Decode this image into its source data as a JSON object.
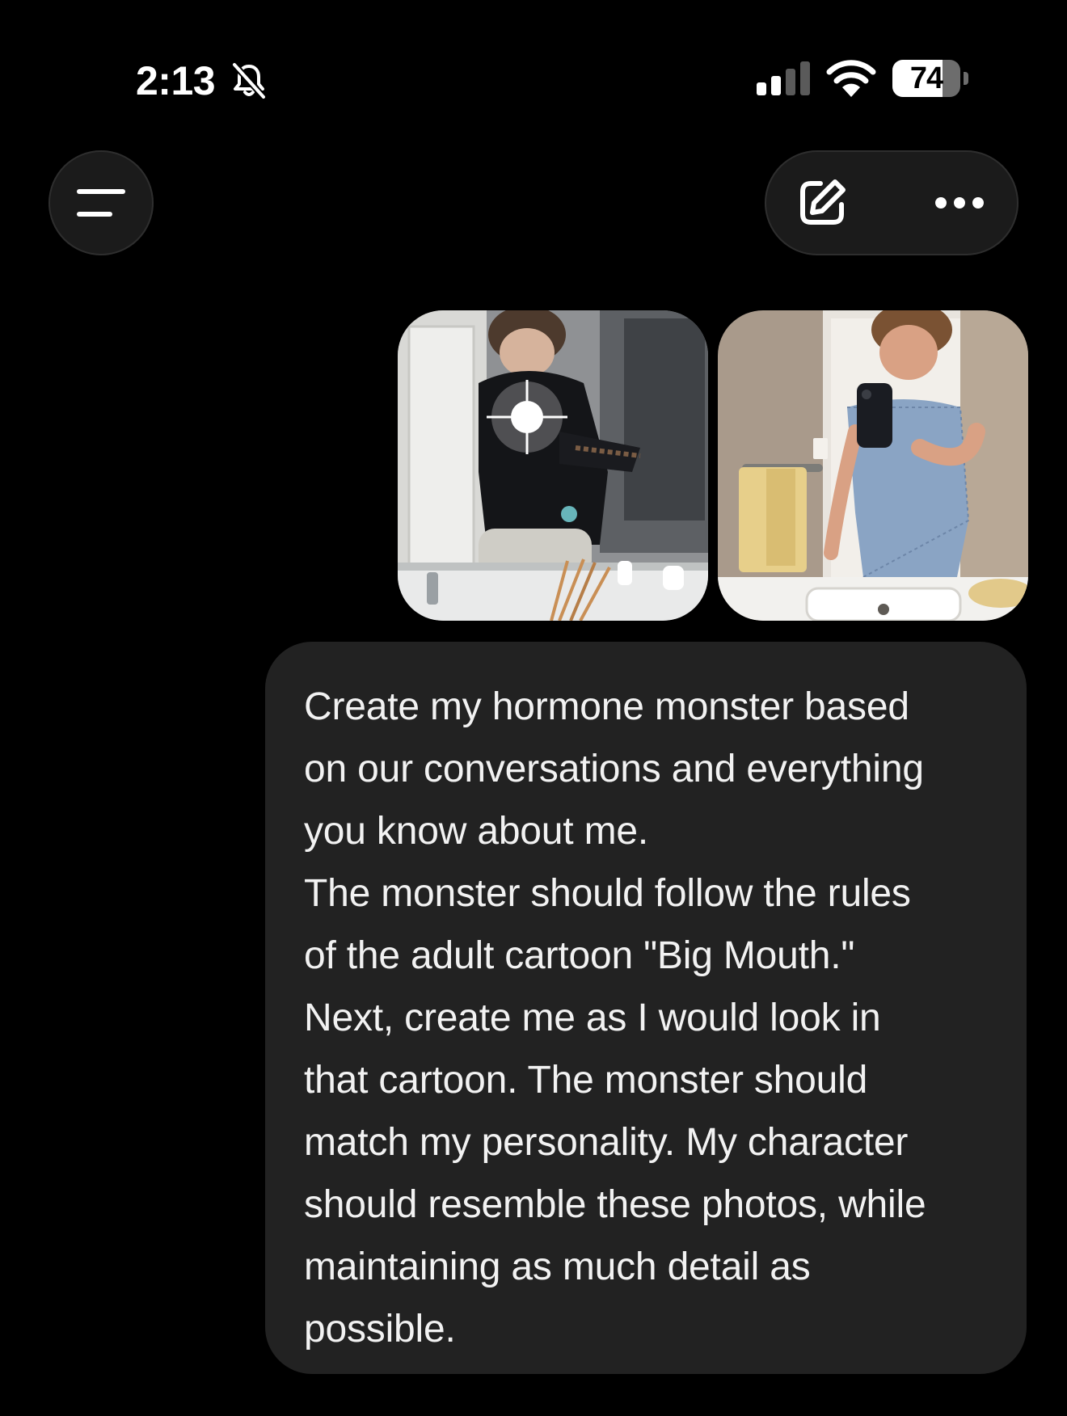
{
  "status_bar": {
    "time": "2:13",
    "battery_level": "74",
    "battery_fraction": 0.74,
    "icons": [
      "bell-slash-icon",
      "cellular-signal-icon",
      "wifi-icon",
      "battery-icon"
    ]
  },
  "nav": {
    "menu_icon": "menu-icon",
    "compose_icon": "compose-icon",
    "more_icon": "ellipsis-icon"
  },
  "message": {
    "attachments_count": 2,
    "lines": [
      "Create my hormone monster based",
      "on our conversations and everything",
      "you know about me.",
      "The monster should follow the rules",
      "of the adult cartoon \"Big Mouth.\"",
      "Next, create me as I would look in",
      "that cartoon. The monster should",
      "match my personality. My character",
      "should resemble these photos, while",
      "maintaining as much detail as",
      "possible."
    ]
  },
  "colors": {
    "background": "#000000",
    "bubble": "#222222",
    "button": "#1b1b1b",
    "text": "#ffffff"
  }
}
